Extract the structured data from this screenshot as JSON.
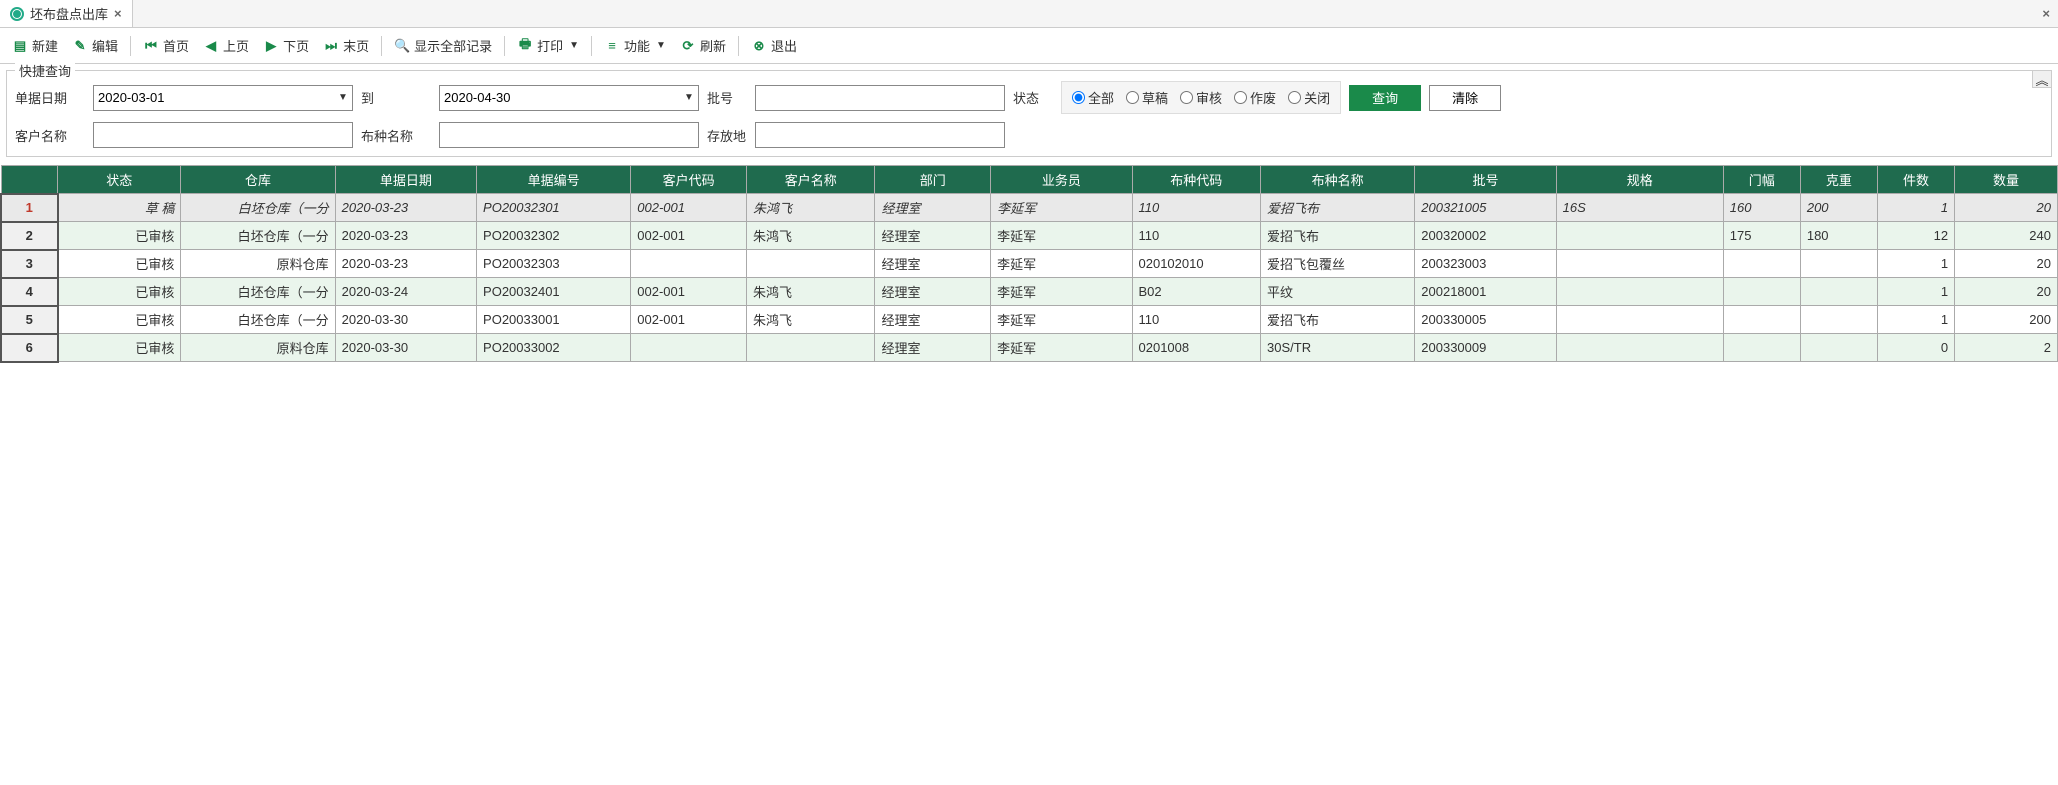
{
  "tab": {
    "title": "坯布盘点出库"
  },
  "toolbar": {
    "new_": "新建",
    "edit": "编辑",
    "first": "首页",
    "prev": "上页",
    "next": "下页",
    "last": "末页",
    "showAll": "显示全部记录",
    "print": "打印",
    "func": "功能",
    "refresh": "刷新",
    "exit": "退出"
  },
  "search": {
    "legend": "快捷查询",
    "labels": {
      "billDate": "单据日期",
      "to": "到",
      "lot": "批号",
      "customer": "客户名称",
      "fabric": "布种名称",
      "location": "存放地",
      "status": "状态"
    },
    "dateFrom": "2020-03-01",
    "dateTo": "2020-04-30",
    "lot": "",
    "customer": "",
    "fabric": "",
    "location": "",
    "statusOptions": {
      "all": "全部",
      "draft": "草稿",
      "audit": "审核",
      "void": "作废",
      "close": "关闭"
    },
    "btnQuery": "查询",
    "btnClear": "清除"
  },
  "grid": {
    "headers": {
      "status": "状态",
      "warehouse": "仓库",
      "billDate": "单据日期",
      "billNo": "单据编号",
      "custCode": "客户代码",
      "custName": "客户名称",
      "dept": "部门",
      "salesman": "业务员",
      "fabricCode": "布种代码",
      "fabricName": "布种名称",
      "lot": "批号",
      "spec": "规格",
      "width": "门幅",
      "gramWeight": "克重",
      "pieces": "件数",
      "qty": "数量"
    },
    "rows": [
      {
        "n": "1",
        "status": "草 稿",
        "warehouse": "白坯仓库（一分",
        "billDate": "2020-03-23",
        "billNo": "PO20032301",
        "custCode": "002-001",
        "custName": "朱鸿飞",
        "dept": "经理室",
        "salesman": "李延军",
        "fabricCode": "110",
        "fabricName": "爱招飞布",
        "lot": "200321005",
        "spec": "16S",
        "width": "160",
        "gramWeight": "200",
        "pieces": "1",
        "qty": "20"
      },
      {
        "n": "2",
        "status": "已审核",
        "warehouse": "白坯仓库（一分",
        "billDate": "2020-03-23",
        "billNo": "PO20032302",
        "custCode": "002-001",
        "custName": "朱鸿飞",
        "dept": "经理室",
        "salesman": "李延军",
        "fabricCode": "110",
        "fabricName": "爱招飞布",
        "lot": "200320002",
        "spec": "",
        "width": "175",
        "gramWeight": "180",
        "pieces": "12",
        "qty": "240"
      },
      {
        "n": "3",
        "status": "已审核",
        "warehouse": "原料仓库",
        "billDate": "2020-03-23",
        "billNo": "PO20032303",
        "custCode": "",
        "custName": "",
        "dept": "经理室",
        "salesman": "李延军",
        "fabricCode": "020102010",
        "fabricName": "爱招飞包覆丝",
        "lot": "200323003",
        "spec": "",
        "width": "",
        "gramWeight": "",
        "pieces": "1",
        "qty": "20"
      },
      {
        "n": "4",
        "status": "已审核",
        "warehouse": "白坯仓库（一分",
        "billDate": "2020-03-24",
        "billNo": "PO20032401",
        "custCode": "002-001",
        "custName": "朱鸿飞",
        "dept": "经理室",
        "salesman": "李延军",
        "fabricCode": "B02",
        "fabricName": "平纹",
        "lot": "200218001",
        "spec": "",
        "width": "",
        "gramWeight": "",
        "pieces": "1",
        "qty": "20"
      },
      {
        "n": "5",
        "status": "已审核",
        "warehouse": "白坯仓库（一分",
        "billDate": "2020-03-30",
        "billNo": "PO20033001",
        "custCode": "002-001",
        "custName": "朱鸿飞",
        "dept": "经理室",
        "salesman": "李延军",
        "fabricCode": "110",
        "fabricName": "爱招飞布",
        "lot": "200330005",
        "spec": "",
        "width": "",
        "gramWeight": "",
        "pieces": "1",
        "qty": "200"
      },
      {
        "n": "6",
        "status": "已审核",
        "warehouse": "原料仓库",
        "billDate": "2020-03-30",
        "billNo": "PO20033002",
        "custCode": "",
        "custName": "",
        "dept": "经理室",
        "salesman": "李延军",
        "fabricCode": "0201008",
        "fabricName": "30S/TR",
        "lot": "200330009",
        "spec": "",
        "width": "",
        "gramWeight": "",
        "pieces": "0",
        "qty": "2"
      }
    ]
  }
}
